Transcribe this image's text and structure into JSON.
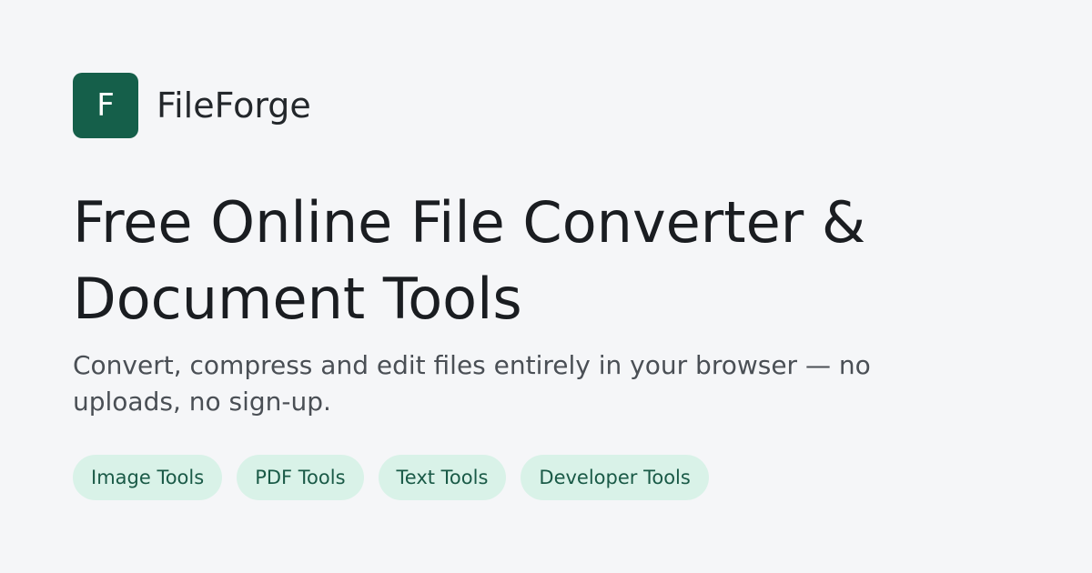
{
  "brand": {
    "logo_letter": "F",
    "name": "FileForge",
    "logo_color": "#155f4a"
  },
  "hero": {
    "headline": "Free Online File Converter & Document Tools",
    "subtitle": "Convert, compress and edit files entirely in your browser — no uploads, no sign-up."
  },
  "categories": [
    {
      "label": "Image Tools"
    },
    {
      "label": "PDF Tools"
    },
    {
      "label": "Text Tools"
    },
    {
      "label": "Developer Tools"
    }
  ],
  "colors": {
    "background": "#f5f6f8",
    "chip_background": "#d9f2e8",
    "chip_text": "#1a5a47"
  }
}
